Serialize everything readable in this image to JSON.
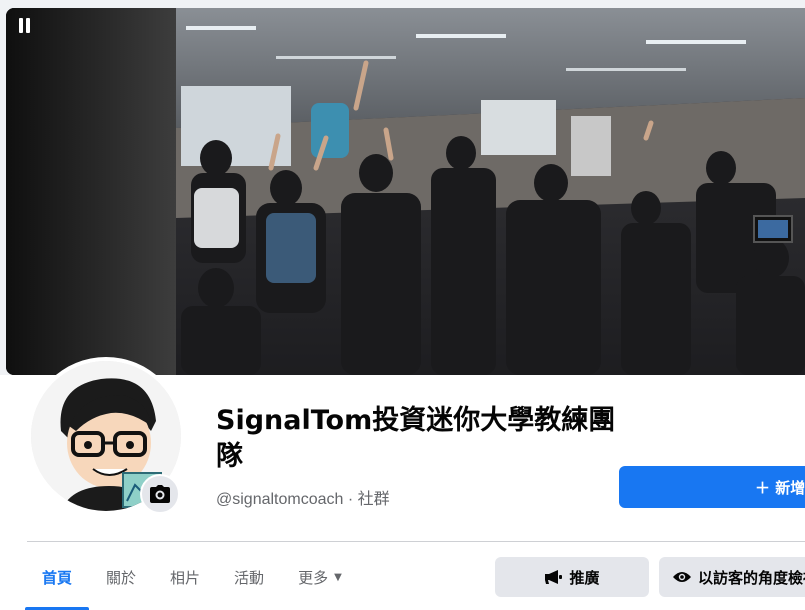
{
  "cover": {
    "pause_label": "pause-video"
  },
  "profile": {
    "name": "SignalTom投資迷你大學教練團隊",
    "handle": "@signaltomcoach · 社群"
  },
  "actions": {
    "new_label": "＋ 新增",
    "promote_label": "推廣",
    "view_as_visitor_label": "以訪客的角度檢視"
  },
  "tabs": [
    {
      "label": "首頁",
      "active": true
    },
    {
      "label": "關於",
      "active": false
    },
    {
      "label": "相片",
      "active": false
    },
    {
      "label": "活動",
      "active": false
    },
    {
      "label": "更多",
      "active": false
    }
  ],
  "colors": {
    "accent": "#1877f2",
    "secondary_button": "#e4e6eb",
    "muted_text": "#65676b"
  },
  "icons": [
    "pause-icon",
    "camera-icon",
    "megaphone-icon",
    "eye-icon",
    "caret-down-icon"
  ]
}
